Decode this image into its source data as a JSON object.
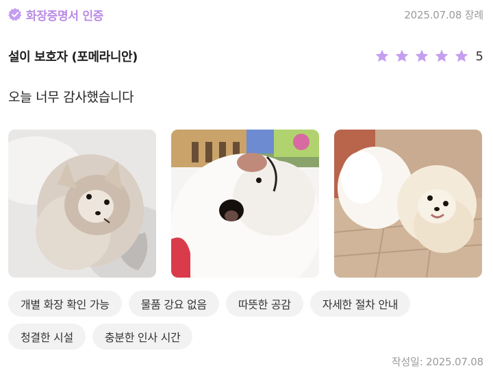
{
  "header": {
    "badge_icon": "verified-check-icon",
    "badge_label": "화장증명서 인증",
    "date_tag": "2025.07.08 장례"
  },
  "review": {
    "author": "설이 보호자 (포메라니안)",
    "rating": 5,
    "rating_label": "5",
    "star_icon": "star-icon",
    "star_color": "#c49ef0",
    "text": "오늘 너무 감사했습니다"
  },
  "photos": [
    {
      "name": "review-photo-1",
      "subject": "pomeranian"
    },
    {
      "name": "review-photo-2",
      "subject": "pomeranian"
    },
    {
      "name": "review-photo-3",
      "subject": "pomeranian"
    }
  ],
  "tags": {
    "row1": [
      "개별 화장 확인 가능",
      "물품 강요 없음",
      "따뜻한 공감",
      "자세한 절차 안내"
    ],
    "row2": [
      "청결한 시설",
      "충분한 인사 시간"
    ]
  },
  "footer": {
    "written": "작성일: 2025.07.08"
  },
  "colors": {
    "accent": "#b98ae6",
    "tag_bg": "#f2f2f2",
    "muted_text": "#9a9a9a"
  }
}
